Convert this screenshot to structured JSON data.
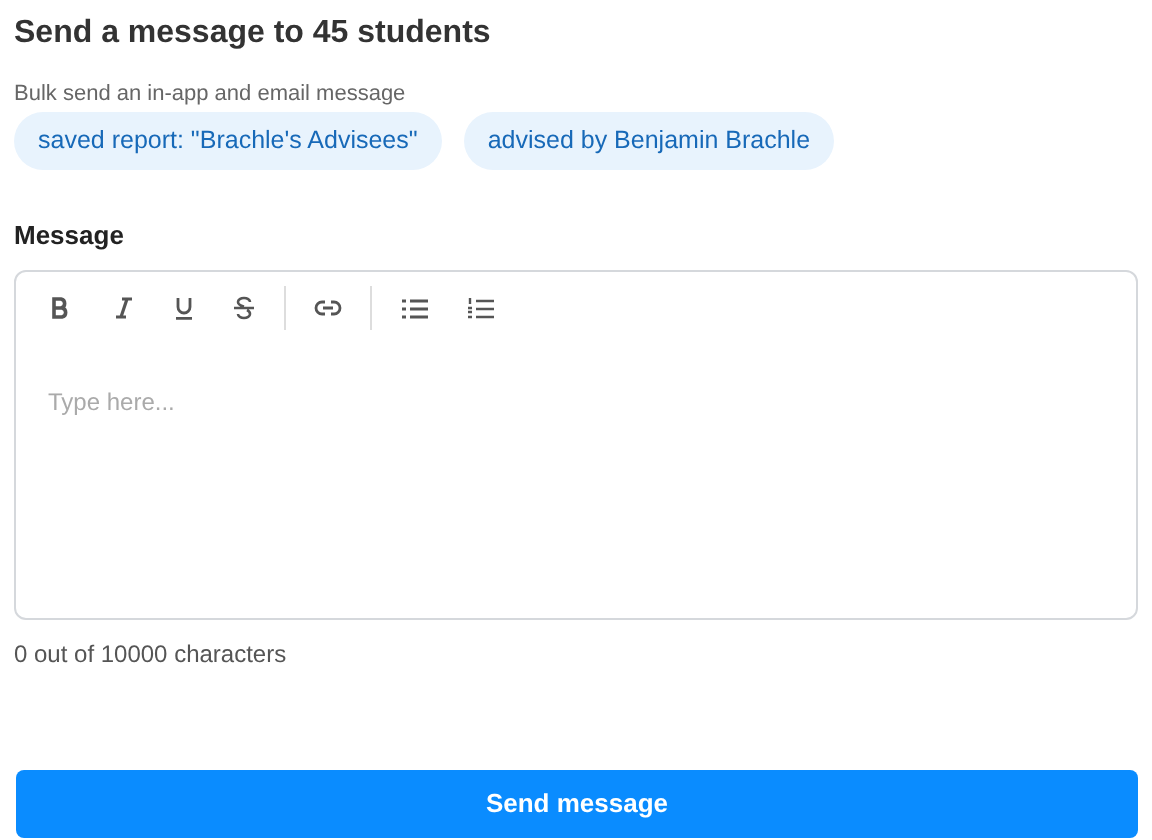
{
  "title": "Send a message to 45 students",
  "subtitle": "Bulk send an in-app and email message",
  "chips": [
    "saved report: \"Brachle's Advisees\"",
    "advised by Benjamin Brachle"
  ],
  "message": {
    "label": "Message",
    "placeholder": "Type here...",
    "counter": "0 out of 10000 characters"
  },
  "button": "Send message"
}
